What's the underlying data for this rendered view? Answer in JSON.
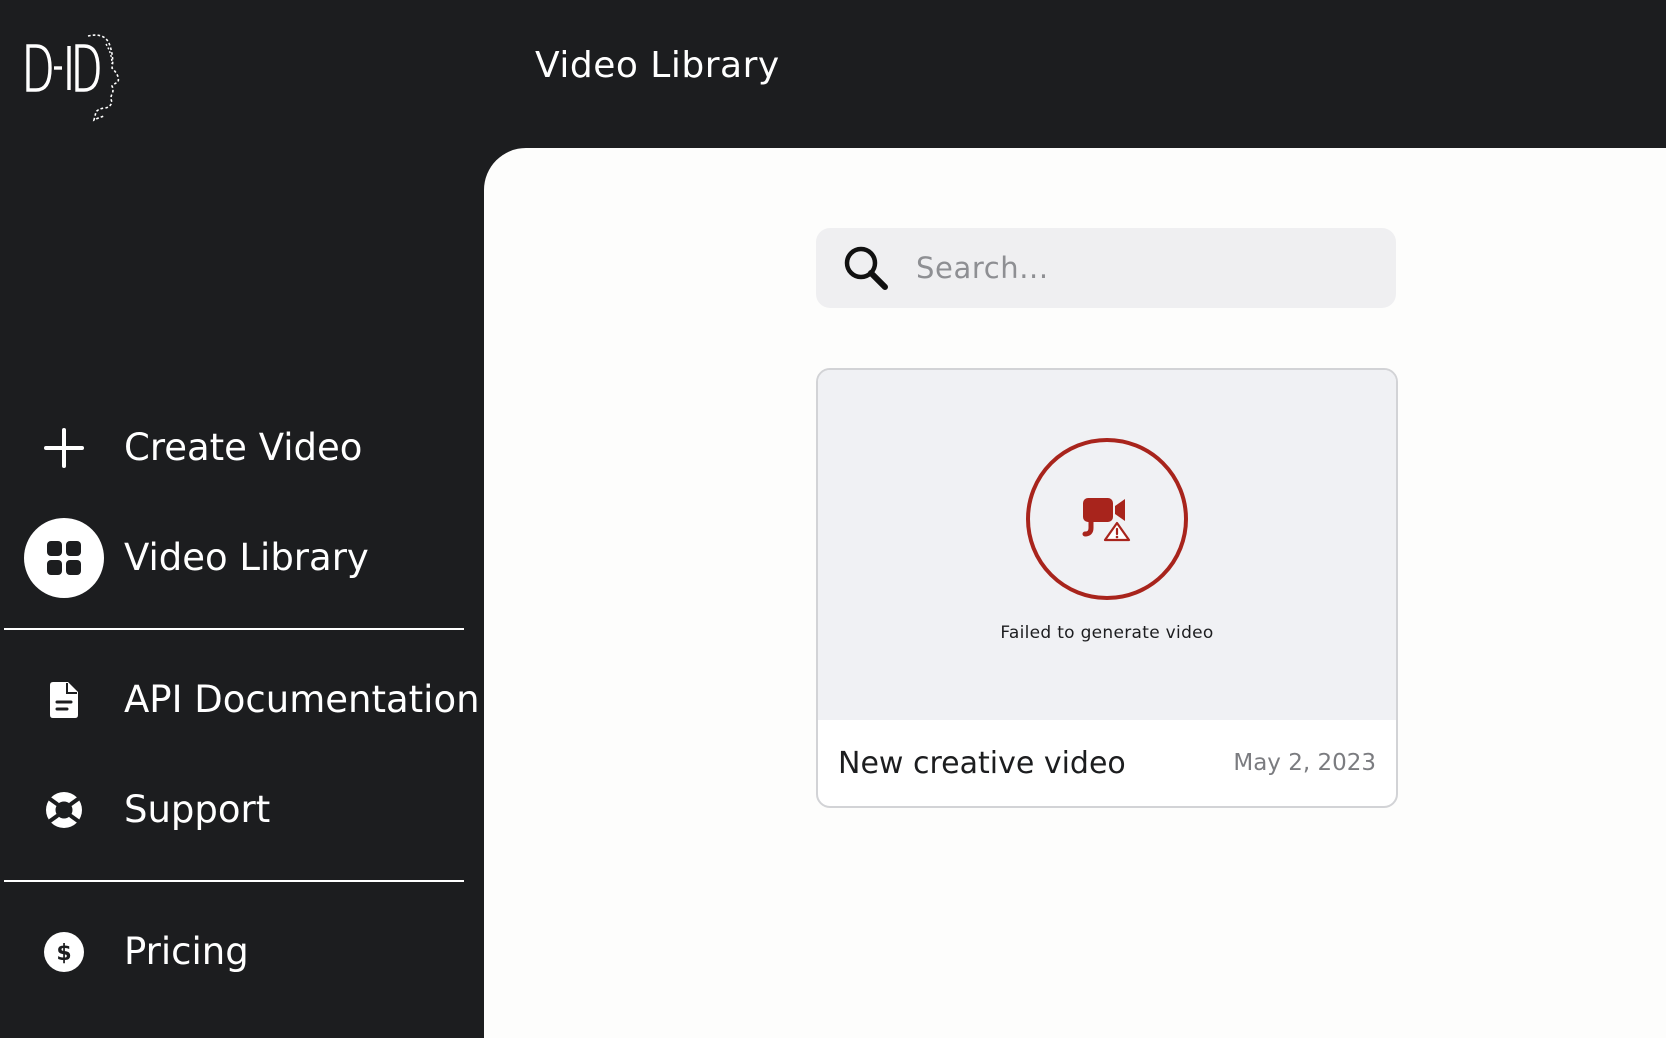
{
  "brand": {
    "logo_text": "D-ID"
  },
  "header": {
    "title": "Video Library"
  },
  "sidebar": {
    "items": [
      {
        "label": "Create Video",
        "icon": "plus-icon"
      },
      {
        "label": "Video Library",
        "icon": "grid-icon",
        "active": true
      },
      {
        "label": "API Documentation",
        "icon": "document-icon"
      },
      {
        "label": "Support",
        "icon": "lifebuoy-icon"
      },
      {
        "label": "Pricing",
        "icon": "dollar-icon"
      }
    ]
  },
  "search": {
    "placeholder": "Search...",
    "value": ""
  },
  "videos": [
    {
      "title": "New creative video",
      "date": "May 2, 2023",
      "status_text": "Failed to generate video",
      "status_icon": "video-failed-icon"
    }
  ],
  "colors": {
    "background": "#1c1d1f",
    "panel": "#fdfdfc",
    "error": "#a8241c"
  }
}
